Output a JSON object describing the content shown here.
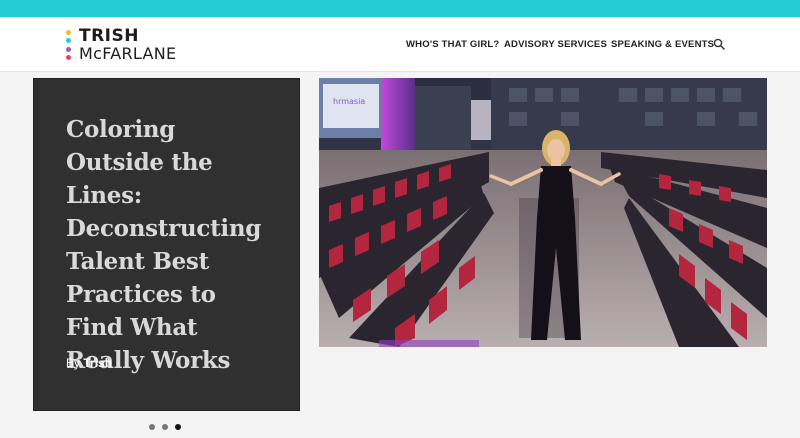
{
  "logo": {
    "line1": "TRISH",
    "line2": "McFARLANE",
    "dot_colors": [
      "#f7b731",
      "#22cdd3",
      "#9b59b6",
      "#e8407a"
    ]
  },
  "nav": {
    "items": [
      {
        "label": "WHO'S THAT GIRL?"
      },
      {
        "label": "ADVISORY SERVICES"
      },
      {
        "label": "SPEAKING & EVENTS"
      }
    ],
    "search_icon": "search-icon"
  },
  "hero": {
    "title": "Coloring Outside the Lines: Deconstructing Talent Best Practices to Find What Really Works",
    "byline_prefix": "By",
    "author": "Trish"
  },
  "photo": {
    "description_icon": "conference-hall-photo",
    "banner_text": "hrmasia"
  },
  "slider": {
    "slide_count": 3,
    "active_index": 2
  },
  "colors": {
    "topbar": "#22cdd3",
    "card_bg": "#303030",
    "title_text": "#d9d9d9"
  }
}
